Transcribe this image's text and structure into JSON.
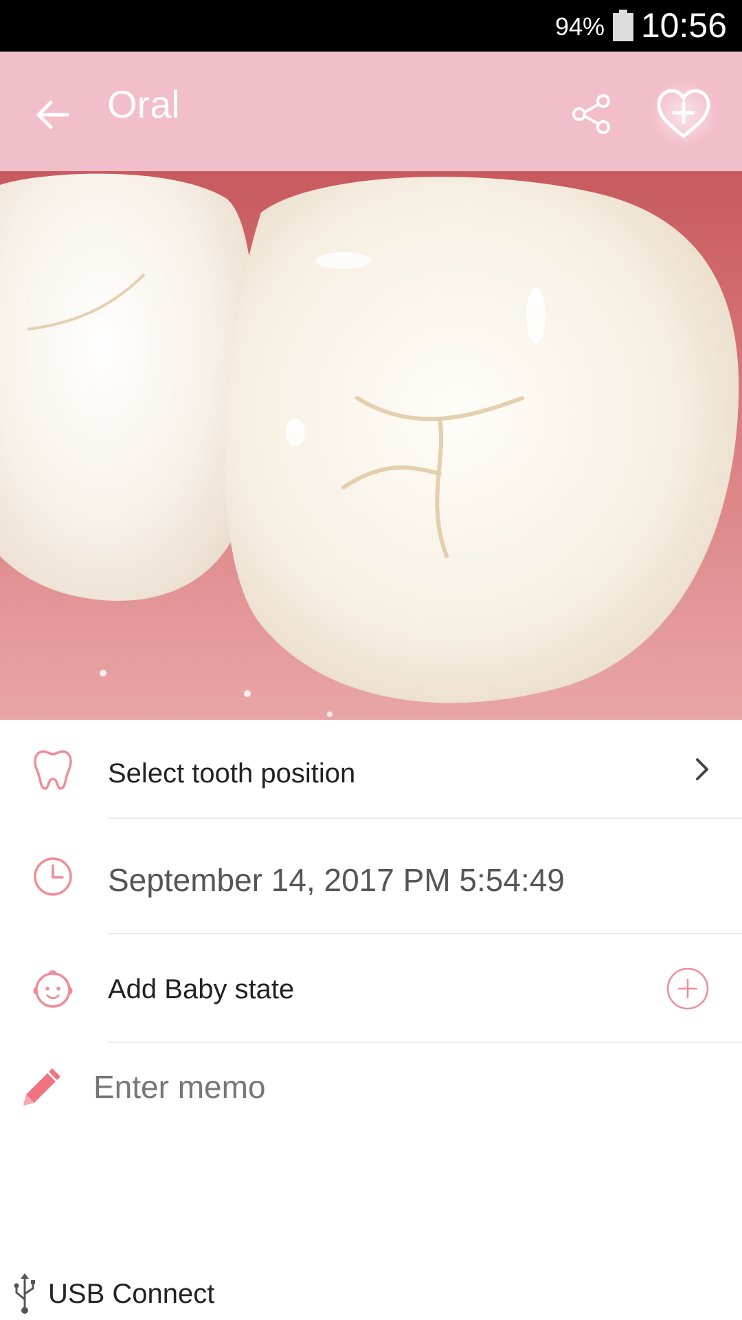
{
  "status_bar": {
    "battery_percent": "94%",
    "time": "10:56",
    "icons": [
      "battery-icon"
    ]
  },
  "app_bar": {
    "title": "Oral",
    "background_color": "#f2bec9",
    "icons": [
      "arrow-left-icon",
      "share-icon",
      "heart-plus-icon"
    ]
  },
  "photo": {
    "subject": "close-up photo of molar teeth"
  },
  "rows": {
    "tooth_position": {
      "label": "Select tooth position",
      "icon": "tooth-icon",
      "trailing_icon": "chevron-right-icon"
    },
    "date": {
      "label": "September 14, 2017 PM 5:54:49",
      "icon": "clock-icon"
    },
    "baby_state": {
      "label": "Add Baby state",
      "icon": "baby-face-icon",
      "trailing_icon": "add-circle-icon"
    }
  },
  "memo": {
    "placeholder": "Enter memo",
    "value": "",
    "icon": "pencil-icon"
  },
  "footer": {
    "usb_label": "USB Connect",
    "icon": "usb-icon"
  },
  "accent_color": "#f08c98"
}
